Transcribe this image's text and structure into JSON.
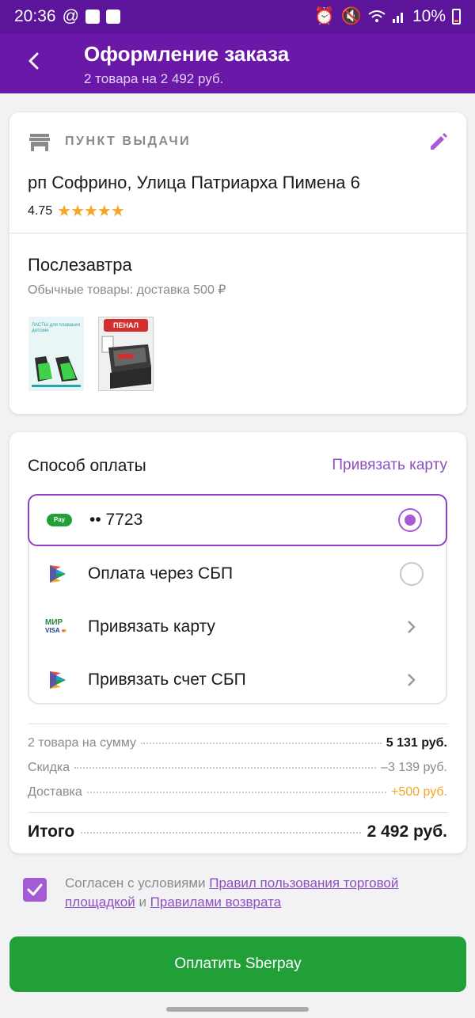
{
  "status_bar": {
    "time": "20:36",
    "battery": "10%"
  },
  "header": {
    "title": "Оформление заказа",
    "subtitle": "2 товара на 2 492 руб."
  },
  "pickup": {
    "label": "ПУНКТ ВЫДАЧИ",
    "address": "рп Софрино, Улица Патриарха Пимена 6",
    "rating": "4.75",
    "stars": "★★★★★"
  },
  "delivery": {
    "title": "Послезавтра",
    "subtitle": "Обычные товары: доставка 500 ₽",
    "product_images": [
      "flippers",
      "pencil-case"
    ],
    "product1_label": "ЛАСТЫ для плавания детские",
    "product2_tag": "ПЕНАЛ"
  },
  "payment": {
    "title": "Способ оплаты",
    "link_card": "Привязать карту",
    "options": [
      {
        "icon": "sberpay-icon",
        "label": "•• 7723",
        "selected": true,
        "kind": "radio"
      },
      {
        "icon": "sbp-icon",
        "label": "Оплата через СБП",
        "selected": false,
        "kind": "radio"
      },
      {
        "icon": "mir-visa-mc-icon",
        "label": "Привязать карту",
        "kind": "chevron"
      },
      {
        "icon": "sbp-icon",
        "label": "Привязать счет СБП",
        "kind": "chevron"
      }
    ],
    "sberpay_badge": "Pay",
    "mir_text": "МИР",
    "visa_text": "VISA"
  },
  "summary": {
    "items_label": "2 товара на сумму",
    "items_value": "5 131 руб.",
    "discount_label": "Скидка",
    "discount_value": "–3 139 руб.",
    "delivery_label": "Доставка",
    "delivery_value": "+500 руб.",
    "total_label": "Итого",
    "total_value": "2 492 руб."
  },
  "agreement": {
    "prefix": "Согласен с условиями ",
    "link1": "Правил пользования торговой площадкой",
    "middle": " и ",
    "link2": "Правилами возврата",
    "checked": true
  },
  "pay_button": {
    "label": "Оплатить Sberpay"
  },
  "colors": {
    "brand_purple": "#6a18a8",
    "accent_purple": "#a55ad6",
    "green": "#21a038",
    "orange": "#f5a623"
  }
}
